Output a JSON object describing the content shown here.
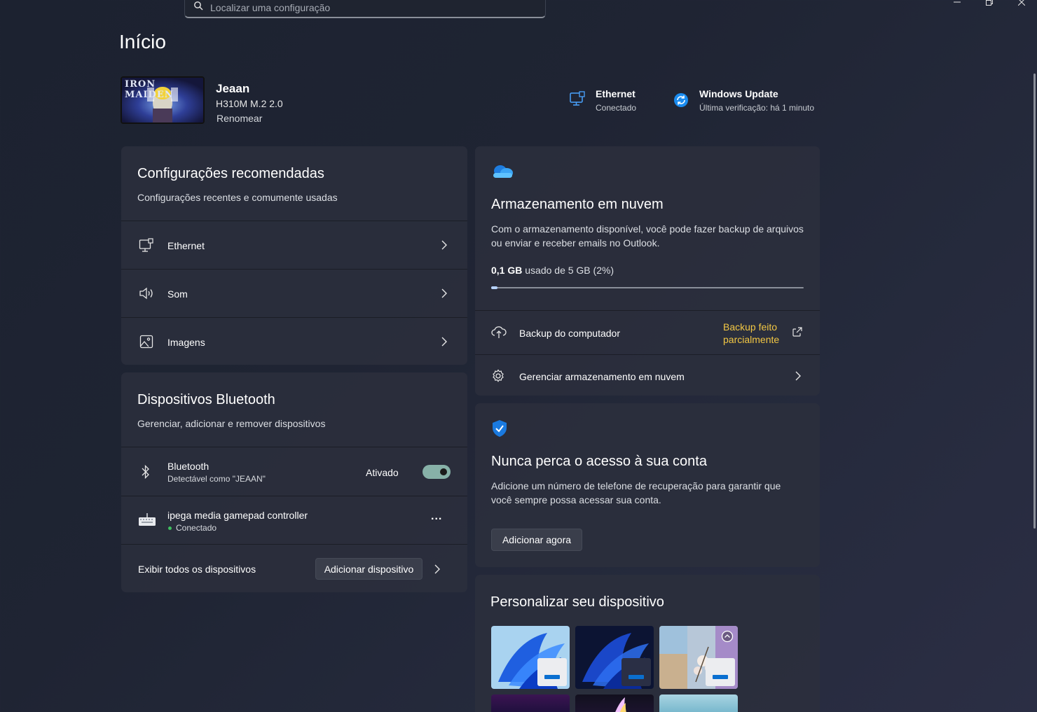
{
  "search": {
    "placeholder": "Localizar uma configuração"
  },
  "page_title": "Início",
  "profile": {
    "name": "Jeaan",
    "model": "H310M M.2 2.0",
    "rename": "Renomear",
    "avatar_text": "IRON MAIDEN"
  },
  "status": {
    "network": {
      "title": "Ethernet",
      "sub": "Conectado"
    },
    "update": {
      "title": "Windows Update",
      "sub": "Última verificação: há 1 minuto"
    }
  },
  "recommended": {
    "title": "Configurações recomendadas",
    "sub": "Configurações recentes e comumente usadas",
    "items": [
      {
        "label": "Ethernet",
        "icon": "ethernet-icon"
      },
      {
        "label": "Som",
        "icon": "speaker-icon"
      },
      {
        "label": "Imagens",
        "icon": "image-icon"
      }
    ]
  },
  "bluetooth": {
    "title": "Dispositivos Bluetooth",
    "sub": "Gerenciar, adicionar e remover dispositivos",
    "bt_label": "Bluetooth",
    "bt_sub": "Detectável como \"JEAAN\"",
    "bt_state": "Ativado",
    "bt_on": true,
    "device_name": "ipega media gamepad controller",
    "device_status": "Conectado",
    "more": "...",
    "view_all": "Exibir todos os dispositivos",
    "add_device": "Adicionar dispositivo"
  },
  "cloud": {
    "title": "Armazenamento em nuvem",
    "desc": "Com o armazenamento disponível, você pode fazer backup de arquivos ou enviar e receber emails no Outlook.",
    "used": "0,1 GB",
    "used_rest": " usado de 5 GB (2%)",
    "used_fraction": 0.02,
    "backup_label": "Backup do computador",
    "backup_status": "Backup feito parcialmente",
    "manage_label": "Gerenciar armazenamento em nuvem"
  },
  "account": {
    "title": "Nunca perca o acesso à sua conta",
    "desc": "Adicione um número de telefone de recuperação para garantir que você sempre possa acessar sua conta.",
    "button": "Adicionar agora"
  },
  "personalize": {
    "title": "Personalizar seu dispositivo"
  },
  "colors": {
    "accent": "#0a6fd0",
    "warning": "#f2c744",
    "connected": "#3fbf5f"
  }
}
